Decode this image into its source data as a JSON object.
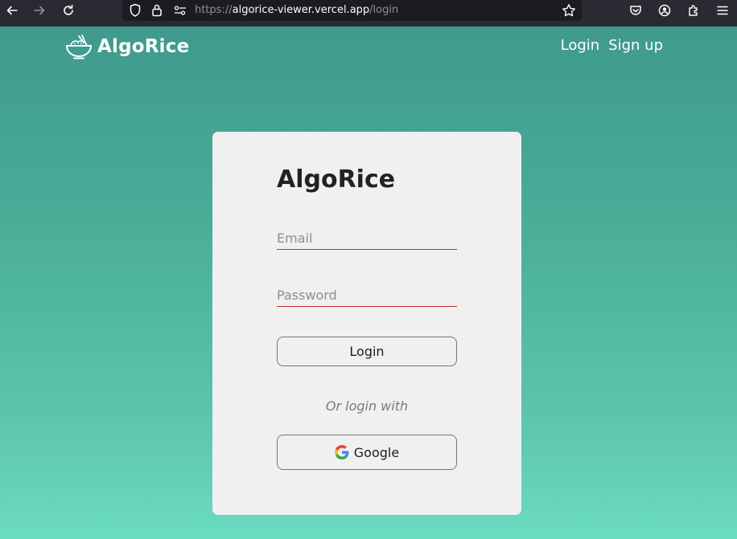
{
  "browser": {
    "url": {
      "scheme": "https://",
      "host": "algorice-viewer.vercel.app",
      "path": "/login"
    },
    "icons": [
      "back-arrow-icon",
      "forward-arrow-icon",
      "reload-icon",
      "shield-icon",
      "lock-icon",
      "permissions-icon",
      "bookmark-star-icon",
      "pocket-icon",
      "account-icon",
      "extensions-icon",
      "menu-icon"
    ]
  },
  "header": {
    "brand": "AlgoRice",
    "brand_icon": "rice-bowl-icon",
    "nav": {
      "login": "Login",
      "signup": "Sign up"
    }
  },
  "login_card": {
    "title": "AlgoRice",
    "email_placeholder": "Email",
    "email_value": "",
    "password_placeholder": "Password",
    "password_value": "",
    "login_button": "Login",
    "or_text": "Or login with",
    "google_button": "Google"
  },
  "colors": {
    "field_underline": "#d0282d",
    "card_bg": "#f0f0f0",
    "gradient_top": "#3f9a8c",
    "gradient_bottom": "#6bdcc0"
  }
}
